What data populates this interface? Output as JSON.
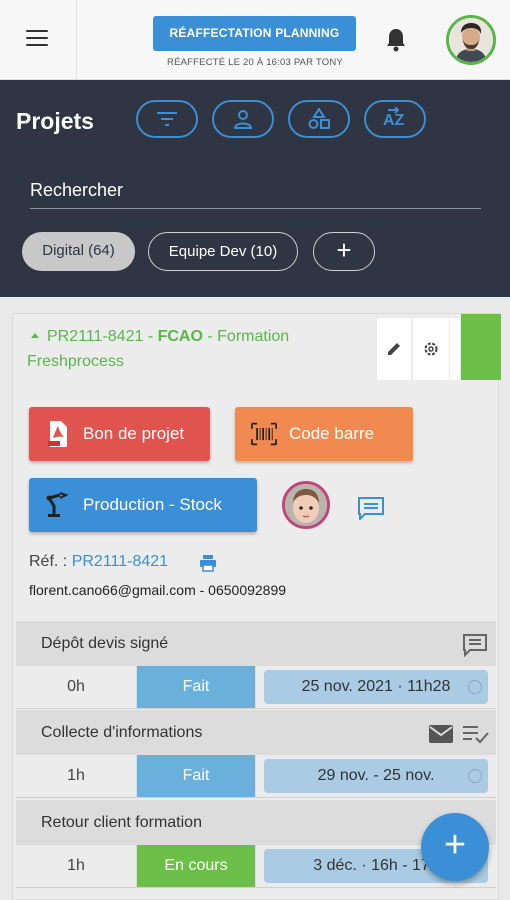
{
  "topbar": {
    "reassign_label": "RÉAFFECTATION PLANNING",
    "reassign_subtitle": "RÉAFFECTÉ LE 20 À 16:03 PAR TONY"
  },
  "header": {
    "title": "Projets",
    "search_placeholder": "Rechercher",
    "chips": [
      "Digital (64)",
      "Equipe Dev (10)",
      "+"
    ]
  },
  "project": {
    "code": "PR2111-8421",
    "separator": " - ",
    "client": "FCAO",
    "name": "Formation Freshprocess",
    "buttons": {
      "bon": "Bon de projet",
      "code": "Code barre",
      "production": "Production - Stock"
    },
    "ref_label": "Réf. :",
    "ref_value": "PR2111-8421",
    "contact": "florent.cano66@gmail.com - 0650092899"
  },
  "tasks": [
    {
      "name": "Dépôt devis signé",
      "hours": "0h",
      "status": "Fait",
      "date": "25 nov. 2021 · 11h28"
    },
    {
      "name": "Collecte d'informations",
      "hours": "1h",
      "status": "Fait",
      "date": "29 nov. - 25 nov."
    },
    {
      "name": "Retour client formation",
      "hours": "1h",
      "status": "En cours",
      "date": "3 déc. · 16h - 17h"
    }
  ],
  "colors": {
    "accent": "#3a8fd6",
    "dark_header": "#2f3542",
    "green": "#6cc04a",
    "red_button": "#e05450",
    "orange_button": "#f08a50"
  }
}
